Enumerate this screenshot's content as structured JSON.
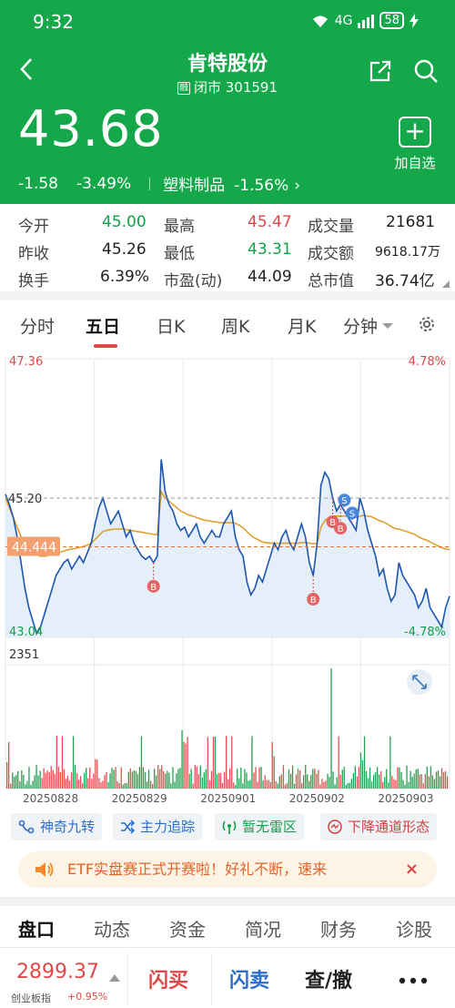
{
  "status_bar": {
    "time": "9:32",
    "network": "4G",
    "battery": "58"
  },
  "header": {
    "title": "肯特股份",
    "rong_badge": "融",
    "subtitle": "闭市 301591",
    "price": "43.68",
    "change": "-1.58",
    "change_pct": "-3.49%",
    "sector": "塑料制品",
    "sector_pct": "-1.56%",
    "sector_arrow": "›",
    "add_label": "加自选",
    "add_symbol": "+"
  },
  "stats": {
    "open_label": "今开",
    "open": "45.00",
    "high_label": "最高",
    "high": "45.47",
    "volume_label": "成交量",
    "volume": "21681",
    "prev_label": "昨收",
    "prev": "45.26",
    "low_label": "最低",
    "low": "43.31",
    "amount_label": "成交额",
    "amount": "9618.17万",
    "turnover_label": "换手",
    "turnover": "6.39%",
    "pe_label": "市盈(动)",
    "pe": "44.09",
    "mcap_label": "总市值",
    "mcap": "36.74亿"
  },
  "chart_tabs": [
    "分时",
    "五日",
    "日K",
    "周K",
    "月K",
    "分钟"
  ],
  "chart_data": {
    "type": "line",
    "price_max": 47.36,
    "price_min": 43.04,
    "pct_max": "4.78%",
    "pct_min": "-4.78%",
    "ref_price_label": "45.20",
    "ref_price": 45.2,
    "avg_label": "44.444",
    "avg_price": 44.444,
    "vol_max_label": "2351",
    "days": [
      "20250828",
      "20250829",
      "20250901",
      "20250902",
      "20250903"
    ],
    "series": [
      {
        "name": "price",
        "values": [
          45.26,
          45.1,
          44.9,
          44.6,
          44.2,
          43.8,
          43.5,
          43.3,
          43.1,
          43.2,
          43.4,
          43.6,
          43.8,
          44.0,
          44.1,
          44.2,
          44.25,
          44.1,
          44.2,
          44.3,
          44.2,
          44.35,
          44.5,
          44.8,
          45.05,
          45.2,
          45.0,
          44.8,
          44.9,
          45.0,
          44.8,
          44.6,
          44.7,
          44.5,
          44.4,
          44.3,
          44.25,
          44.3,
          44.2,
          44.3,
          45.8,
          45.3,
          45.1,
          45.0,
          44.8,
          44.7,
          44.75,
          44.6,
          44.7,
          44.8,
          44.6,
          44.5,
          44.6,
          44.7,
          44.6,
          44.6,
          44.8,
          44.9,
          45.0,
          44.6,
          44.4,
          44.3,
          43.9,
          43.7,
          43.8,
          44.0,
          43.9,
          44.1,
          44.3,
          44.5,
          44.4,
          44.6,
          44.7,
          44.5,
          44.4,
          44.6,
          44.8,
          44.6,
          44.2,
          44.0,
          44.5,
          45.4,
          45.6,
          45.5,
          45.2,
          45.0,
          45.1,
          45.0,
          44.9,
          44.8,
          44.7,
          45.2,
          45.0,
          44.7,
          44.5,
          44.3,
          44.0,
          44.1,
          43.8,
          43.6,
          43.7,
          44.2,
          44.0,
          43.9,
          43.8,
          43.7,
          43.5,
          43.6,
          43.8,
          43.5,
          43.4,
          43.3,
          43.2,
          43.5,
          43.68
        ]
      },
      {
        "name": "avg",
        "values": [
          45.2,
          45.05,
          44.9,
          44.75,
          44.6,
          44.5,
          44.42,
          44.36,
          44.32,
          44.3,
          44.3,
          44.31,
          44.32,
          44.34,
          44.36,
          44.38,
          44.4,
          44.41,
          44.42,
          44.43,
          44.45,
          44.47,
          44.5,
          44.56,
          44.62,
          44.68,
          44.7,
          44.71,
          44.72,
          44.72,
          44.72,
          44.71,
          44.7,
          44.69,
          44.68,
          44.67,
          44.66,
          44.65,
          44.64,
          44.63,
          45.3,
          45.2,
          45.15,
          45.1,
          45.05,
          45.0,
          44.97,
          44.94,
          44.92,
          44.9,
          44.88,
          44.86,
          44.85,
          44.84,
          44.83,
          44.82,
          44.82,
          44.82,
          44.82,
          44.81,
          44.78,
          44.74,
          44.68,
          44.62,
          44.58,
          44.55,
          44.52,
          44.51,
          44.5,
          44.5,
          44.5,
          44.5,
          44.5,
          44.5,
          44.5,
          44.5,
          44.51,
          44.51,
          44.5,
          44.49,
          44.5,
          44.75,
          44.85,
          44.9,
          44.92,
          44.92,
          44.92,
          44.92,
          44.92,
          44.91,
          44.9,
          44.92,
          44.93,
          44.92,
          44.91,
          44.88,
          44.85,
          44.83,
          44.8,
          44.76,
          44.73,
          44.72,
          44.7,
          44.68,
          44.66,
          44.64,
          44.6,
          44.57,
          44.55,
          44.52,
          44.49,
          44.46,
          44.43,
          44.41,
          44.4
        ]
      }
    ],
    "trade_marks": [
      {
        "label": "B",
        "index": 38,
        "type": "buy"
      },
      {
        "label": "B",
        "index": 79,
        "type": "buy"
      },
      {
        "label": "S",
        "index": 87,
        "type": "sell"
      },
      {
        "label": "S",
        "index": 89,
        "type": "sell"
      },
      {
        "label": "B",
        "index": 86,
        "type": "buy"
      },
      {
        "label": "B",
        "index": 84,
        "type": "buy"
      }
    ]
  },
  "signals": [
    "神奇九转",
    "主力追踪",
    "暂无雷区",
    "下降通道形态"
  ],
  "banner": {
    "text": "ETF实盘赛正式开赛啦！好礼不断，速来",
    "close": "×"
  },
  "bottom_tabs": [
    "盘口",
    "动态",
    "资金",
    "简况",
    "财务",
    "诊股"
  ],
  "index": {
    "value": "2899.37",
    "name": "创业板指",
    "change": "+0.95%"
  },
  "actions": {
    "flash_buy": "闪买",
    "flash_sell": "闪卖",
    "query": "查/撤",
    "more": "•••"
  }
}
